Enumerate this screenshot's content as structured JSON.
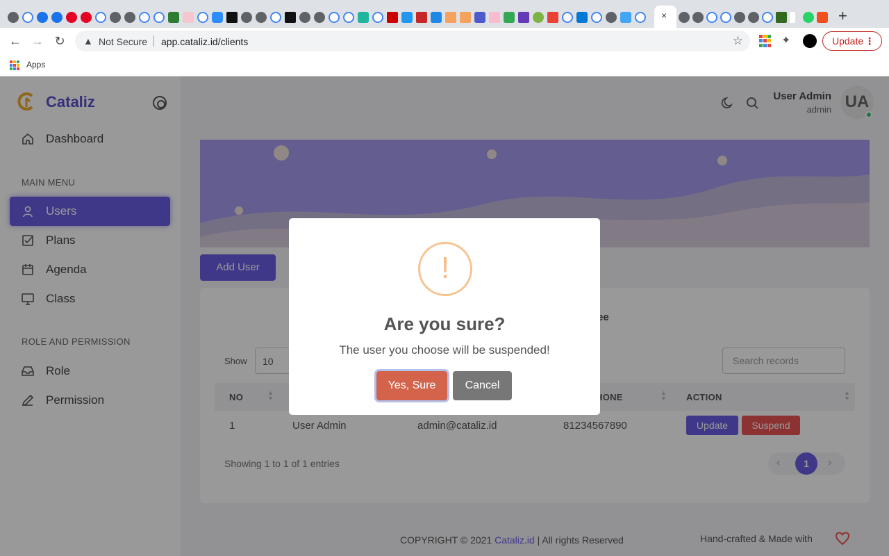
{
  "browser": {
    "tab_close": "×",
    "new_tab": "+",
    "security_label": "Not Secure",
    "url": "app.cataliz.id/clients",
    "update_label": "Update",
    "update_menu": "⋮",
    "bookmarks": {
      "apps_label": "Apps"
    }
  },
  "sidebar": {
    "brand": "Cataliz",
    "dashboard": "Dashboard",
    "section_main": "MAIN MENU",
    "items_main": [
      {
        "label": "Users",
        "icon": "user-icon"
      },
      {
        "label": "Plans",
        "icon": "checkbox-icon"
      },
      {
        "label": "Agenda",
        "icon": "calendar-icon"
      },
      {
        "label": "Class",
        "icon": "monitor-icon"
      }
    ],
    "section_role": "ROLE AND PERMISSION",
    "items_role": [
      {
        "label": "Role",
        "icon": "inbox-icon"
      },
      {
        "label": "Permission",
        "icon": "pen-icon"
      }
    ]
  },
  "header": {
    "user_name": "User Admin",
    "user_role": "admin",
    "avatar_initials": "UA"
  },
  "main": {
    "add_user_label": "Add User",
    "card_title_fragment": "ee",
    "show_label": "Show",
    "page_size": "10",
    "search_placeholder": "Search records",
    "columns": [
      "NO",
      "HONE",
      "ACTION"
    ],
    "rows": [
      {
        "no": "1",
        "name": "User Admin",
        "email": "admin@cataliz.id",
        "phone": "81234567890"
      }
    ],
    "row_update_label": "Update",
    "row_suspend_label": "Suspend",
    "showing_text": "Showing 1 to 1 of 1 entries",
    "pager": {
      "prev": "‹",
      "current": "1",
      "next": "›"
    }
  },
  "footer": {
    "copyright_prefix": "COPYRIGHT © 2021 ",
    "brand_link": "Cataliz.id",
    "copyright_suffix": " | All rights Reserved",
    "right_text": "Hand-crafted & Made with"
  },
  "modal": {
    "icon": "!",
    "title": "Are you sure?",
    "text": "The user you choose will be suspended!",
    "confirm_label": "Yes, Sure",
    "cancel_label": "Cancel"
  },
  "colors": {
    "brand": "#6a5ee5",
    "danger": "#ea5455",
    "confirm": "#d4634c",
    "warning_ring": "#f8c291"
  }
}
